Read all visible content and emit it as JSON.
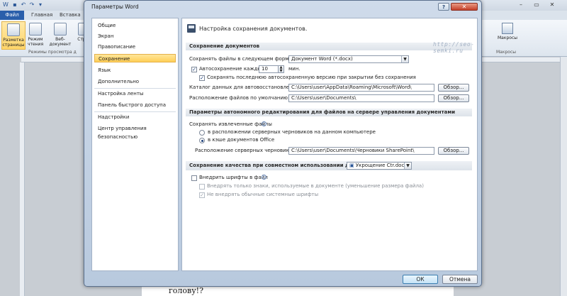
{
  "word": {
    "file_tab": "Файл",
    "tabs": [
      "Главная",
      "Вставка"
    ],
    "ribbon_buttons": [
      "Разметка страницы",
      "Режим чтения",
      "Веб-документ",
      "Стр"
    ],
    "group_label": "Режимы просмотра д",
    "macros_label": "Макросы",
    "macros_group": "Макросы",
    "page_text": "голову!?"
  },
  "dialog": {
    "title": "Параметры Word",
    "help": "?",
    "close": "✕",
    "nav": [
      {
        "label": "Общие"
      },
      {
        "label": "Экран"
      },
      {
        "label": "Правописание"
      },
      {
        "label": "Сохранение",
        "selected": true
      },
      {
        "label": "Язык"
      },
      {
        "label": "Дополнительно"
      },
      {
        "label": "Настройка ленты"
      },
      {
        "label": "Панель быстрого доступа"
      },
      {
        "label": "Надстройки"
      },
      {
        "label": "Центр управления безопасностью"
      }
    ],
    "header": "Настройка сохранения документов.",
    "watermark": "http://seo-semki.ru",
    "save_docs": {
      "section": "Сохранение документов",
      "format_label": "Сохранять файлы в следующем формате:",
      "format_value": "Документ Word (*.docx)",
      "autosave_label": "Автосохранение каждые",
      "autosave_value": "10",
      "autosave_unit": "мин.",
      "autosave_checked": true,
      "keep_last_label": "Сохранять последнюю автосохраненную версию при закрытии без сохранения",
      "keep_last_checked": true,
      "autorecover_label": "Каталог данных для автовосстановления:",
      "autorecover_path": "C:\\Users\\user\\AppData\\Roaming\\Microsoft\\Word\\",
      "default_label": "Расположение файлов по умолчанию:",
      "default_path": "C:\\Users\\user\\Documents\\",
      "browse": "Обзор..."
    },
    "offline": {
      "section": "Параметры автономного редактирования для файлов на сервере управления документами",
      "checked_out_label": "Сохранять извлеченные файлы",
      "radio1": "в расположении серверных черновиков на данном компьютере",
      "radio2": "в кэше документов Office",
      "selected_radio": 2,
      "drafts_label": "Расположение серверных черновиков:",
      "drafts_path": "C:\\Users\\user\\Documents\\Черновики SharePoint\\",
      "browse": "Обзор..."
    },
    "fidelity": {
      "section": "Сохранение качества при совместном использовании документа:",
      "document": "Укрощение Ctr.docx",
      "embed_label": "Внедрить шрифты в файл",
      "embed_checked": false,
      "only_used_label": "Внедрять только знаки, используемые в документе (уменьшение размера файла)",
      "only_used_checked": false,
      "no_system_label": "Не внедрять обычные системные шрифты",
      "no_system_checked": true
    },
    "ok": "ОК",
    "cancel": "Отмена"
  }
}
